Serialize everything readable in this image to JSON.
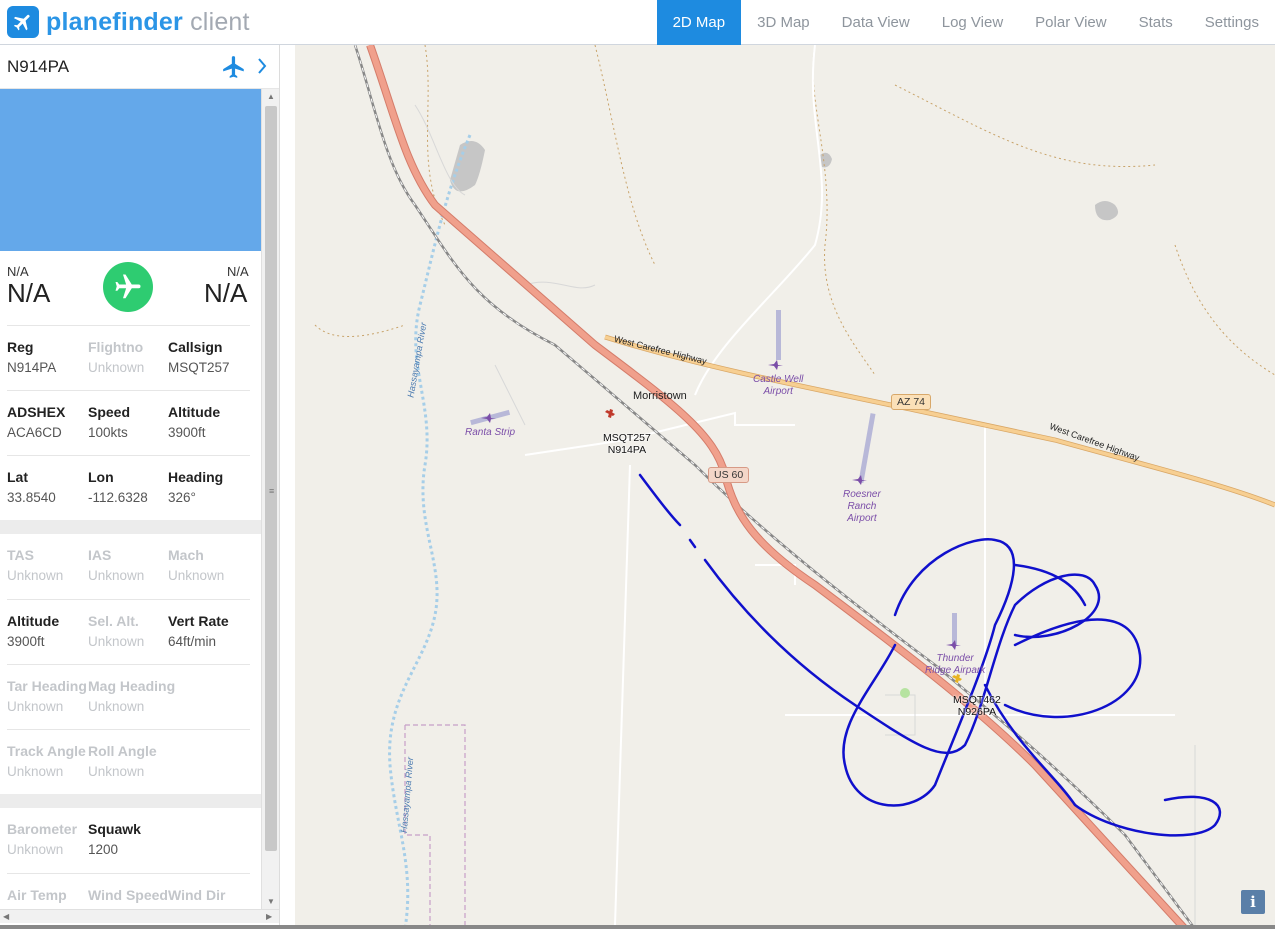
{
  "app": {
    "logo_brand": "planefinder",
    "logo_suffix": "client"
  },
  "nav": {
    "tabs": [
      {
        "label": "2D Map",
        "active": true
      },
      {
        "label": "3D Map",
        "active": false
      },
      {
        "label": "Data View",
        "active": false
      },
      {
        "label": "Log View",
        "active": false
      },
      {
        "label": "Polar View",
        "active": false
      },
      {
        "label": "Stats",
        "active": false
      },
      {
        "label": "Settings",
        "active": false
      }
    ]
  },
  "sidebar": {
    "selected_reg": "N914PA",
    "plane_icon": "plane-icon",
    "route": {
      "origin_small": "N/A",
      "origin_big": "N/A",
      "dest_small": "N/A",
      "dest_big": "N/A",
      "status_icon": "airborne-plane-icon",
      "status_color": "#2ecc71"
    },
    "groups": [
      [
        {
          "label": "Reg",
          "value": "N914PA",
          "dim": false
        },
        {
          "label": "Flightno",
          "value": "Unknown",
          "dim": true
        },
        {
          "label": "Callsign",
          "value": "MSQT257",
          "dim": false
        }
      ],
      [
        {
          "label": "ADSHEX",
          "value": "ACA6CD",
          "dim": false
        },
        {
          "label": "Speed",
          "value": "100kts",
          "dim": false
        },
        {
          "label": "Altitude",
          "value": "3900ft",
          "dim": false
        }
      ],
      [
        {
          "label": "Lat",
          "value": "33.8540",
          "dim": false
        },
        {
          "label": "Lon",
          "value": "-112.6328",
          "dim": false
        },
        {
          "label": "Heading",
          "value": "326°",
          "dim": false
        }
      ],
      [
        {
          "label": "TAS",
          "value": "Unknown",
          "dim": true
        },
        {
          "label": "IAS",
          "value": "Unknown",
          "dim": true
        },
        {
          "label": "Mach",
          "value": "Unknown",
          "dim": true
        }
      ],
      [
        {
          "label": "Altitude",
          "value": "3900ft",
          "dim": false
        },
        {
          "label": "Sel. Alt.",
          "value": "Unknown",
          "dim": true
        },
        {
          "label": "Vert Rate",
          "value": "64ft/min",
          "dim": false
        }
      ],
      [
        {
          "label": "Tar Heading",
          "value": "Unknown",
          "dim": true
        },
        {
          "label": "Mag Heading",
          "value": "Unknown",
          "dim": true
        }
      ],
      [
        {
          "label": "Track Angle",
          "value": "Unknown",
          "dim": true
        },
        {
          "label": "Roll Angle",
          "value": "Unknown",
          "dim": true
        }
      ],
      [
        {
          "label": "Barometer",
          "value": "Unknown",
          "dim": true
        },
        {
          "label": "Squawk",
          "value": "1200",
          "dim": false
        }
      ],
      [
        {
          "label": "Air Temp",
          "value": "",
          "dim": true
        },
        {
          "label": "Wind Speed",
          "value": "",
          "dim": true
        },
        {
          "label": "Wind Dir",
          "value": "",
          "dim": true
        }
      ]
    ]
  },
  "map": {
    "places": {
      "town": "Morristown",
      "highway_w": "West Carefree Highway",
      "highway_e": "West Carefree Highway",
      "river_n": "Hassayampa River",
      "river_s": "Hassayampa River",
      "az74": "AZ 74",
      "us60": "US 60"
    },
    "airports": {
      "ranta": "Ranta Strip",
      "castle_1": "Castle Well",
      "castle_2": "Airport",
      "roesner_1": "Roesner",
      "roesner_2": "Ranch",
      "roesner_3": "Airport",
      "thunder_1": "Thunder",
      "thunder_2": "Ridge Airpark"
    },
    "aircraft": [
      {
        "callsign": "MSQT257",
        "reg": "N914PA",
        "color": "#c0392b"
      },
      {
        "callsign": "MSQT462",
        "reg": "N926PA",
        "color": "#e8b321"
      }
    ],
    "track_color": "#1010cc",
    "info_label": "i"
  }
}
